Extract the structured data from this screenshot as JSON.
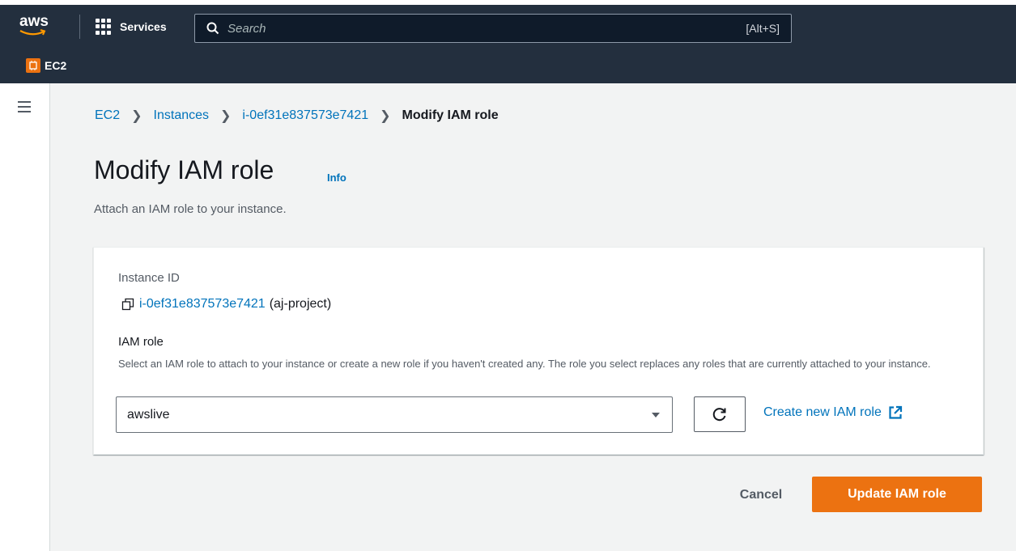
{
  "topbar": {
    "logo_text": "aws",
    "services_label": "Services",
    "search_placeholder": "Search",
    "search_shortcut": "[Alt+S]",
    "service_name": "EC2",
    "bg_color": "#232f3e"
  },
  "breadcrumb": {
    "items": [
      "EC2",
      "Instances",
      "i-0ef31e837573e7421"
    ],
    "current": "Modify IAM role"
  },
  "page": {
    "title": "Modify IAM role",
    "info_label": "Info",
    "description": "Attach an IAM role to your instance."
  },
  "form": {
    "instance_id_label": "Instance ID",
    "instance_id": "i-0ef31e837573e7421",
    "instance_name": "(aj-project)",
    "iam_role_label": "IAM role",
    "iam_role_description": "Select an IAM role to attach to your instance or create a new role if you haven't created any. The role you select replaces any roles that are currently attached to your instance.",
    "iam_role_selected": "awslive",
    "create_role_link": "Create new IAM role"
  },
  "actions": {
    "cancel_label": "Cancel",
    "update_label": "Update IAM role",
    "primary_color": "#ec7211"
  },
  "icons": {
    "menu": "hamburger-icon",
    "services": "grid-icon",
    "search": "search-icon",
    "copy": "copy-icon",
    "dropdown": "caret-down-icon",
    "refresh": "refresh-icon",
    "external": "external-link-icon"
  }
}
